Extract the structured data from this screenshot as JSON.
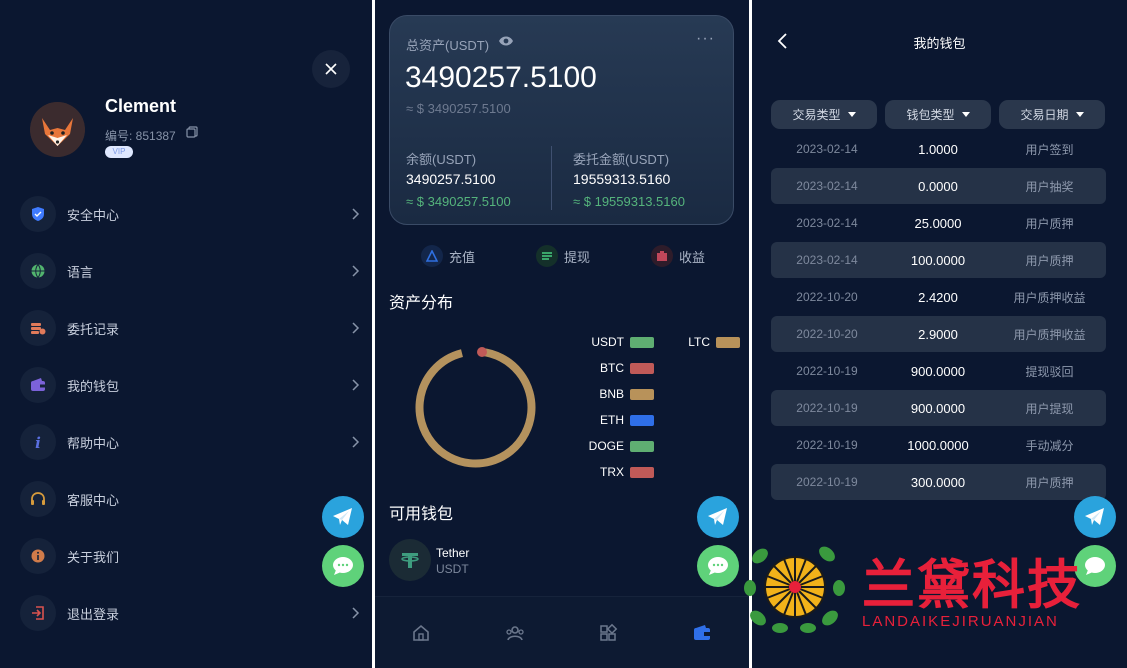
{
  "drawer": {
    "user": {
      "name": "Clement",
      "id_text": "编号: 851387",
      "badge": "VIP"
    },
    "menu": [
      {
        "label": "安全中心",
        "icon": "shield-icon",
        "color": "#3f7bff"
      },
      {
        "label": "语言",
        "icon": "globe-icon",
        "color": "#52b46e"
      },
      {
        "label": "委托记录",
        "icon": "records-icon",
        "color": "#e07a5a"
      },
      {
        "label": "我的钱包",
        "icon": "wallet-icon",
        "color": "#7b62d9"
      },
      {
        "label": "帮助中心",
        "icon": "info-italic-icon",
        "color": "#5a6fe0"
      },
      {
        "label": "客服中心",
        "icon": "headset-icon",
        "color": "#d59a3c"
      },
      {
        "label": "关于我们",
        "icon": "info-circle-icon",
        "color": "#d07b4a"
      },
      {
        "label": "退出登录",
        "icon": "logout-icon",
        "color": "#d9534f"
      }
    ]
  },
  "asset": {
    "title": "总资产(USDT)",
    "more": "···",
    "total": "3490257.5100",
    "approx": "≈ $ 3490257.5100",
    "balance_label": "余额(USDT)",
    "balance_value": "3490257.5100",
    "balance_approx": "≈ $ 3490257.5100",
    "entrust_label": "委托金额(USDT)",
    "entrust_value": "19559313.5160",
    "entrust_approx": "≈ $ 19559313.5160"
  },
  "actions": [
    {
      "label": "充值",
      "icon": "deposit-icon",
      "color": "#2f6fe0"
    },
    {
      "label": "提现",
      "icon": "withdraw-icon",
      "color": "#3aa56a"
    },
    {
      "label": "收益",
      "icon": "earnings-icon",
      "color": "#c0475a"
    }
  ],
  "distribution": {
    "title": "资产分布",
    "legend": [
      {
        "name": "USDT",
        "color": "#5fae72"
      },
      {
        "name": "LTC",
        "color": "#b8925a"
      },
      {
        "name": "BTC",
        "color": "#c05a58"
      },
      {
        "name": "BNB",
        "color": "#b8925a"
      },
      {
        "name": "ETH",
        "color": "#2f6fe8"
      },
      {
        "name": "DOGE",
        "color": "#5fae72"
      },
      {
        "name": "TRX",
        "color": "#c05a58"
      }
    ],
    "ring_color": "#b4925e",
    "marker_color": "#c05a58"
  },
  "wallets": {
    "title": "可用钱包",
    "coin_name": "Tether",
    "coin_symbol": "USDT"
  },
  "bottom_nav": [
    "home-icon",
    "users-icon",
    "apps-icon",
    "wallet-icon"
  ],
  "wallet_page": {
    "title": "我的钱包",
    "filters": [
      "交易类型",
      "钱包类型",
      "交易日期"
    ],
    "rows": [
      {
        "date": "2023-02-14",
        "amount": "1.0000",
        "type": "用户签到"
      },
      {
        "date": "2023-02-14",
        "amount": "0.0000",
        "type": "用户抽奖"
      },
      {
        "date": "2023-02-14",
        "amount": "25.0000",
        "type": "用户质押"
      },
      {
        "date": "2023-02-14",
        "amount": "100.0000",
        "type": "用户质押"
      },
      {
        "date": "2022-10-20",
        "amount": "2.4200",
        "type": "用户质押收益"
      },
      {
        "date": "2022-10-20",
        "amount": "2.9000",
        "type": "用户质押收益"
      },
      {
        "date": "2022-10-19",
        "amount": "900.0000",
        "type": "提现驳回"
      },
      {
        "date": "2022-10-19",
        "amount": "900.0000",
        "type": "用户提现"
      },
      {
        "date": "2022-10-19",
        "amount": "1000.0000",
        "type": "手动减分"
      },
      {
        "date": "2022-10-19",
        "amount": "300.0000",
        "type": "用户质押"
      }
    ]
  },
  "watermark": {
    "title": "兰黛科技",
    "subtitle": "LANDAIKEJIRUANJIAN",
    "color": "#e8203a"
  }
}
